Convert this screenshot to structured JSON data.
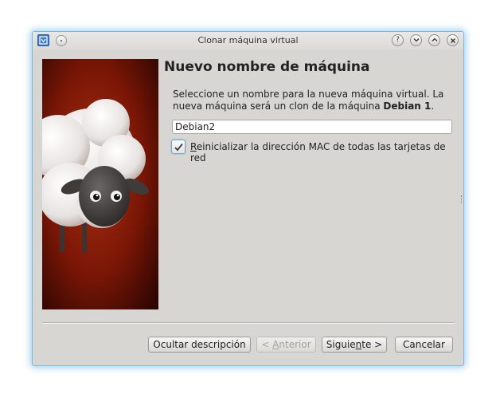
{
  "window": {
    "title": "Clonar máquina virtual",
    "icons": {
      "app": "virtualbox-icon",
      "menu": "window-menu-icon",
      "help": "help-icon",
      "minimize": "minimize-icon",
      "maximize": "maximize-icon",
      "close": "close-icon"
    },
    "help_glyph": "?"
  },
  "page": {
    "title": "Nuevo nombre de máquina",
    "description_prefix": "Seleccione un nombre para la nueva máquina virtual. La nueva máquina será un clon de la máquina ",
    "source_vm": "Debian 1",
    "description_suffix": ".",
    "name_value": "Debian2",
    "reinit_mac": {
      "checked": true,
      "mnemonic": "R",
      "label_rest": "einicializar la dirección MAC de todas las tarjetas de red"
    }
  },
  "buttons": {
    "hide_description": "Ocultar descripción",
    "back_prefix": "< ",
    "back_mnemonic": "A",
    "back_rest": "nterior",
    "next_prefix": "Siguie",
    "next_mnemonic": "n",
    "next_rest": "te >",
    "cancel": "Cancelar"
  },
  "colors": {
    "window_bg": "#d8d6d3",
    "focus_glow": "#7ab8dd",
    "banner_red": "#7a1606"
  }
}
